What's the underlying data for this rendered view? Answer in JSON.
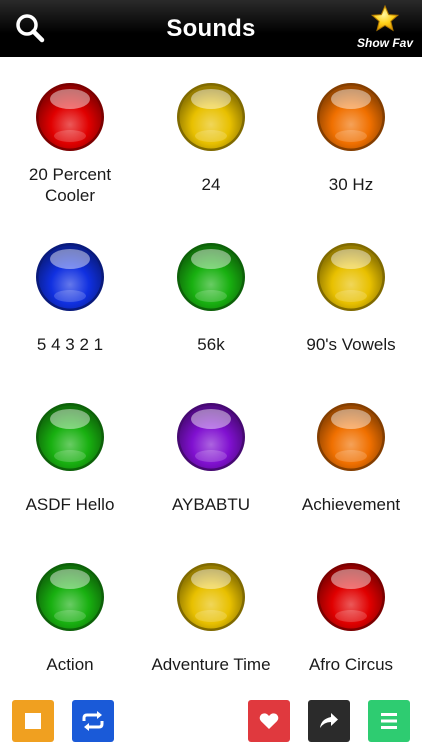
{
  "header": {
    "title": "Sounds",
    "fav_label": "Show Fav"
  },
  "icons": {
    "search": "search-icon",
    "star": "star-icon",
    "stop": "stop-icon",
    "repeat": "repeat-icon",
    "heart": "heart-icon",
    "share": "share-icon",
    "menu": "menu-icon"
  },
  "colors": {
    "red": "#e00000",
    "yellow": "#e8c000",
    "orange": "#f07000",
    "blue": "#1030e0",
    "green": "#18b010",
    "purple": "#8010d0",
    "stop_btn": "#f0a020",
    "repeat_btn": "#1a5ad8",
    "heart_btn": "#e0393e",
    "share_btn": "#2b2b2b",
    "menu_btn": "#2ecc71"
  },
  "sounds": [
    {
      "line1": "20 Percent",
      "line2": "Cooler",
      "color": "red"
    },
    {
      "line1": "24",
      "line2": "",
      "color": "yellow"
    },
    {
      "line1": "30 Hz",
      "line2": "",
      "color": "orange"
    },
    {
      "line1": "5 4 3 2 1",
      "line2": "",
      "color": "blue"
    },
    {
      "line1": "56k",
      "line2": "",
      "color": "green"
    },
    {
      "line1": "90's Vowels",
      "line2": "",
      "color": "yellow"
    },
    {
      "line1": "ASDF Hello",
      "line2": "",
      "color": "green"
    },
    {
      "line1": "AYBABTU",
      "line2": "",
      "color": "purple"
    },
    {
      "line1": "Achievement",
      "line2": "",
      "color": "orange"
    },
    {
      "line1": "Action",
      "line2": "",
      "color": "green"
    },
    {
      "line1": "Adventure Time",
      "line2": "",
      "color": "yellow"
    },
    {
      "line1": "Afro Circus",
      "line2": "",
      "color": "red"
    }
  ]
}
